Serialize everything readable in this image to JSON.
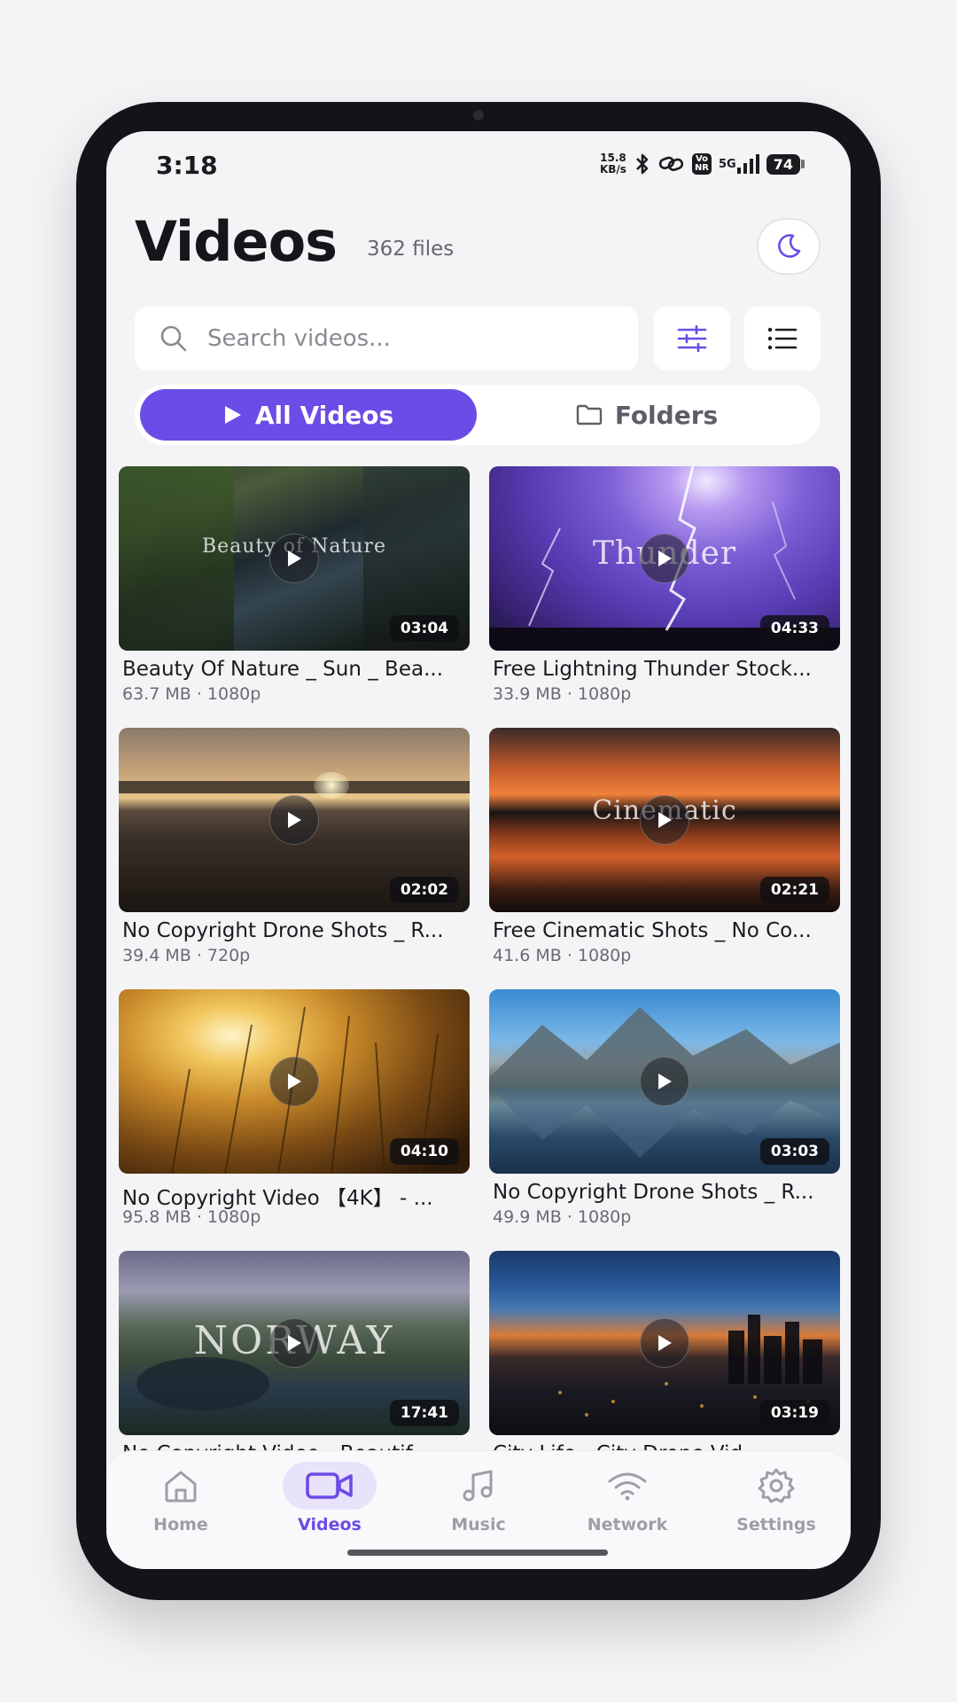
{
  "status_bar": {
    "time": "3:18",
    "net_speed_value": "15.8",
    "net_speed_unit": "KB/s",
    "volte_top": "Vo",
    "volte_bottom": "NR",
    "network_type": "5G",
    "battery": "74"
  },
  "header": {
    "title": "Videos",
    "file_count": "362 files"
  },
  "search": {
    "placeholder": "Search videos...",
    "value": ""
  },
  "tabs": [
    {
      "label": "All Videos",
      "active": true
    },
    {
      "label": "Folders",
      "active": false
    }
  ],
  "videos": [
    {
      "title": "Beauty Of Nature _ Sun _ Bea...",
      "size": "63.7 MB",
      "resolution": "1080p",
      "duration": "03:04",
      "overlay": "Beauty of Nature"
    },
    {
      "title": "Free Lightning Thunder Stock...",
      "size": "33.9 MB",
      "resolution": "1080p",
      "duration": "04:33",
      "overlay": "Thunder"
    },
    {
      "title": "No Copyright Drone Shots _ R...",
      "size": "39.4 MB",
      "resolution": "720p",
      "duration": "02:02",
      "overlay": ""
    },
    {
      "title": "Free Cinematic Shots _ No Co...",
      "size": "41.6 MB",
      "resolution": "1080p",
      "duration": "02:21",
      "overlay": "Cinematic"
    },
    {
      "title": "No Copyright Video 【4K】 - ...",
      "size": "95.8 MB",
      "resolution": "1080p",
      "duration": "04:10",
      "overlay": ""
    },
    {
      "title": "No Copyright Drone Shots _ R...",
      "size": "49.9 MB",
      "resolution": "1080p",
      "duration": "03:03",
      "overlay": ""
    },
    {
      "title": "No Copyright Video - Beautif...",
      "size": "",
      "resolution": "",
      "duration": "17:41",
      "overlay": "NORWAY"
    },
    {
      "title": "City Life - City Drone Vid...",
      "size": "",
      "resolution": "",
      "duration": "03:19",
      "overlay": ""
    }
  ],
  "bottom_nav": [
    {
      "label": "Home",
      "icon": "home-icon",
      "active": false
    },
    {
      "label": "Videos",
      "icon": "video-camera-icon",
      "active": true
    },
    {
      "label": "Music",
      "icon": "music-note-icon",
      "active": false
    },
    {
      "label": "Network",
      "icon": "wifi-icon",
      "active": false
    },
    {
      "label": "Settings",
      "icon": "gear-icon",
      "active": false
    }
  ],
  "colors": {
    "accent": "#6b4ce6",
    "accent_soft": "#e8e2fb",
    "background": "#f4f4f6",
    "text_primary": "#1b1b1f",
    "text_secondary": "#6a6a72"
  }
}
